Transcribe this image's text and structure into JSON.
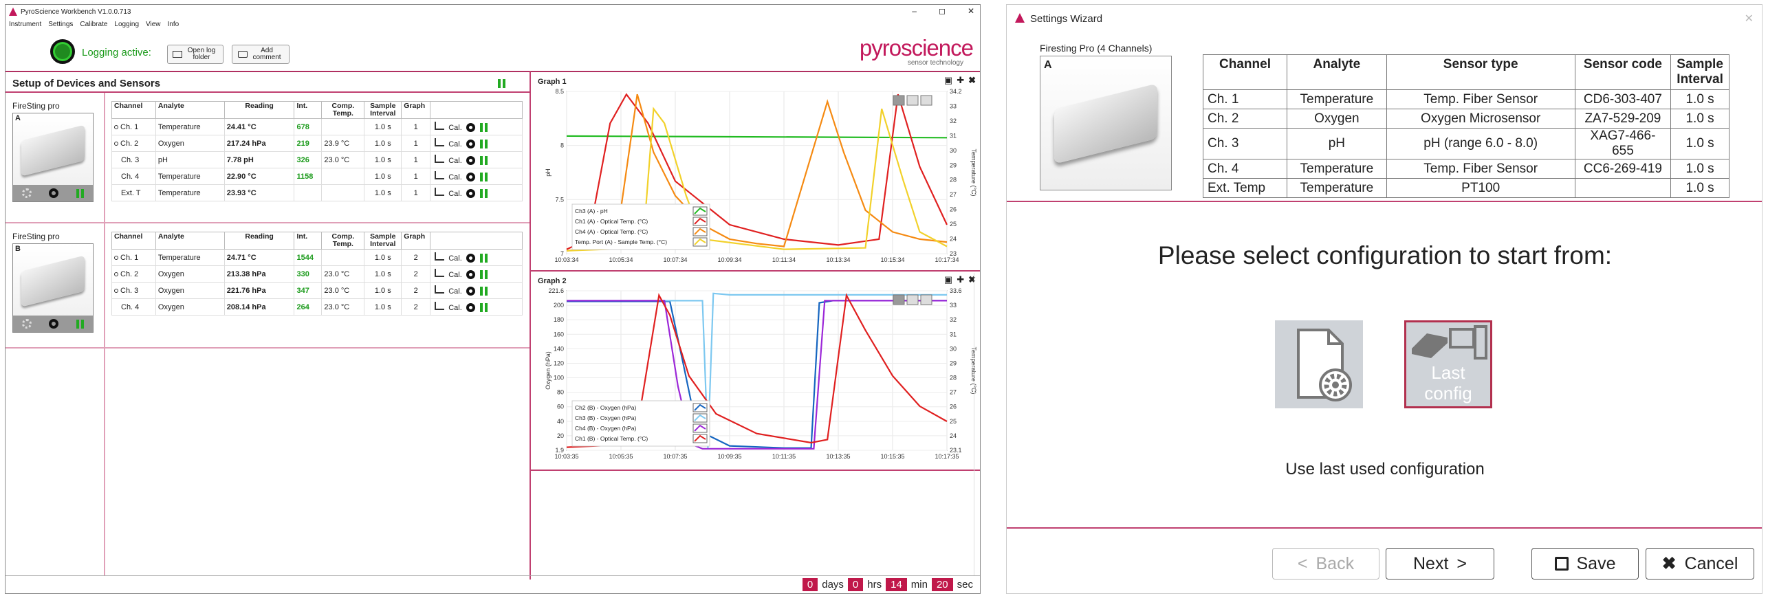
{
  "main": {
    "title": "PyroScience Workbench V1.0.0.713",
    "window_buttons": [
      "–",
      "◻",
      "✕"
    ],
    "menu": [
      "Instrument",
      "Settings",
      "Calibrate",
      "Logging",
      "View",
      "Info"
    ],
    "logging_status": "Logging active:",
    "open_log_folder": "Open log folder",
    "add_comment": "Add comment",
    "logo": "pyroscience",
    "logo_sub": "sensor technology",
    "setup_header": "Setup of Devices and Sensors",
    "headers": [
      "Channel",
      "Analyte",
      "Reading",
      "Int.",
      "Comp. Temp.",
      "Sample Interval",
      "Graph"
    ],
    "cal_label": "Cal.",
    "devices": [
      {
        "name": "FireSting pro",
        "letter": "A",
        "rows": [
          {
            "ch": "Ch. 1",
            "analyte": "Temperature",
            "reading": "24.41 °C",
            "int": "678",
            "comp": "",
            "si": "1.0 s",
            "graph": "1",
            "dot": true
          },
          {
            "ch": "Ch. 2",
            "analyte": "Oxygen",
            "reading": "217.24 hPa",
            "int": "219",
            "comp": "23.9 °C",
            "si": "1.0 s",
            "graph": "1",
            "dot": true
          },
          {
            "ch": "Ch. 3",
            "analyte": "pH",
            "reading": "7.78 pH",
            "int": "326",
            "comp": "23.0 °C",
            "si": "1.0 s",
            "graph": "1",
            "dot": false
          },
          {
            "ch": "Ch. 4",
            "analyte": "Temperature",
            "reading": "22.90 °C",
            "int": "1158",
            "comp": "",
            "si": "1.0 s",
            "graph": "1",
            "dot": false
          },
          {
            "ch": "Ext. T",
            "analyte": "Temperature",
            "reading": "23.93 °C",
            "int": "",
            "comp": "",
            "si": "1.0 s",
            "graph": "1",
            "dot": false
          }
        ]
      },
      {
        "name": "FireSting pro",
        "letter": "B",
        "rows": [
          {
            "ch": "Ch. 1",
            "analyte": "Temperature",
            "reading": "24.71 °C",
            "int": "1544",
            "comp": "",
            "si": "1.0 s",
            "graph": "2",
            "dot": true
          },
          {
            "ch": "Ch. 2",
            "analyte": "Oxygen",
            "reading": "213.38 hPa",
            "int": "330",
            "comp": "23.0 °C",
            "si": "1.0 s",
            "graph": "2",
            "dot": true
          },
          {
            "ch": "Ch. 3",
            "analyte": "Oxygen",
            "reading": "221.76 hPa",
            "int": "347",
            "comp": "23.0 °C",
            "si": "1.0 s",
            "graph": "2",
            "dot": true
          },
          {
            "ch": "Ch. 4",
            "analyte": "Oxygen",
            "reading": "208.14 hPa",
            "int": "264",
            "comp": "23.0 °C",
            "si": "1.0 s",
            "graph": "2",
            "dot": false
          }
        ]
      }
    ],
    "graph1": {
      "title": "Graph 1"
    },
    "graph2": {
      "title": "Graph 2"
    },
    "elapsed": {
      "days": "0",
      "days_label": "days",
      "hrs": "0",
      "hrs_label": "hrs",
      "min": "14",
      "min_label": "min",
      "sec": "20",
      "sec_label": "sec"
    }
  },
  "chart_data": [
    {
      "type": "line",
      "title": "Graph 1",
      "ylabel": "pH",
      "y2label": "Temperature (°C)",
      "ylim": [
        6.5,
        8.5
      ],
      "y2lim": [
        23,
        34.2
      ],
      "yticks": [
        "8.5",
        "8",
        "7.5",
        "7"
      ],
      "y2ticks": [
        "34.2",
        "33",
        "32",
        "31",
        "30",
        "29",
        "28",
        "27",
        "26",
        "25",
        "24",
        "23"
      ],
      "x_ticks": [
        "10:03:34",
        "10:05:34",
        "10:07:34",
        "10:09:34",
        "10:11:34",
        "10:13:34",
        "10:15:34",
        "10:17:34"
      ],
      "grid": true,
      "legend_position": "bottom-left",
      "series": [
        {
          "name": "Ch3 (A) - pH",
          "color": "#22bb22",
          "axis": "left",
          "x": [
            0,
            14
          ],
          "y": [
            7.95,
            7.93
          ]
        },
        {
          "name": "Ch1 (A) - Optical Temp. (°C)",
          "color": "#e02020",
          "axis": "right",
          "x": [
            0,
            0.8,
            1.6,
            2.2,
            3,
            4,
            6,
            8,
            10,
            11.5,
            12.2,
            13,
            14
          ],
          "y": [
            23.3,
            24,
            32,
            34,
            32,
            28,
            25,
            24,
            23.6,
            24,
            34,
            29,
            25
          ]
        },
        {
          "name": "Ch4 (A) - Optical Temp. (°C)",
          "color": "#f58a12",
          "axis": "right",
          "x": [
            0,
            1.8,
            2.6,
            3.2,
            4,
            5,
            6,
            7,
            8,
            9.6,
            10.2,
            11,
            12,
            13,
            14
          ],
          "y": [
            23.2,
            23.5,
            34,
            30,
            27,
            25,
            24,
            23.7,
            23.5,
            33.5,
            30,
            26,
            24.5,
            24,
            23.8
          ]
        },
        {
          "name": "Temp. Port (A) - Sample Temp. (°C)",
          "color": "#f2d12a",
          "axis": "right",
          "x": [
            0,
            2.8,
            3.2,
            3.6,
            4.4,
            5,
            8,
            11,
            11.6,
            12.4,
            13,
            14
          ],
          "y": [
            23.2,
            23.4,
            33,
            32,
            27,
            24,
            23.3,
            23.4,
            33,
            28,
            24.5,
            23.5
          ]
        }
      ]
    },
    {
      "type": "line",
      "title": "Graph 2",
      "ylabel": "Oxygen (hPa)",
      "y2label": "Temperature (°C)",
      "ylim": [
        1.9,
        221.6
      ],
      "y2lim": [
        23.1,
        33.6
      ],
      "yticks": [
        "221.6",
        "200",
        "180",
        "160",
        "140",
        "120",
        "100",
        "80",
        "60",
        "40",
        "20",
        "1.9"
      ],
      "y2ticks": [
        "33.6",
        "33",
        "32",
        "31",
        "30",
        "29",
        "28",
        "27",
        "26",
        "25",
        "24",
        "23.1"
      ],
      "x_ticks": [
        "10:03:35",
        "10:05:35",
        "10:07:35",
        "10:09:35",
        "10:11:35",
        "10:13:35",
        "10:15:35",
        "10:17:35"
      ],
      "grid": true,
      "legend_position": "bottom-left",
      "series": [
        {
          "name": "Ch2 (B) - Oxygen (hPa)",
          "color": "#1565c0",
          "axis": "left",
          "x": [
            0,
            3.8,
            4.3,
            4.8,
            6,
            8,
            9,
            9.3,
            9.8,
            14
          ],
          "y": [
            207,
            207,
            120,
            30,
            8,
            5,
            5,
            205,
            208,
            208
          ]
        },
        {
          "name": "Ch3 (B) - Oxygen (hPa)",
          "color": "#7dc8f0",
          "axis": "left",
          "x": [
            0,
            5,
            5.2,
            5.4,
            6,
            14
          ],
          "y": [
            208,
            208,
            5,
            218,
            216,
            216
          ]
        },
        {
          "name": "Ch4 (B) - Oxygen (hPa)",
          "color": "#9c27d8",
          "axis": "left",
          "x": [
            0,
            3.6,
            4.1,
            4.6,
            5,
            8,
            9.1,
            9.5,
            14
          ],
          "y": [
            208,
            208,
            90,
            10,
            4,
            4,
            4,
            208,
            208
          ]
        },
        {
          "name": "Ch1 (B) - Optical Temp. (°C)",
          "color": "#e02020",
          "axis": "right",
          "x": [
            0,
            2.5,
            3.4,
            3.8,
            4.5,
            5.5,
            7,
            9,
            9.6,
            10.3,
            11,
            12,
            13,
            14
          ],
          "y": [
            23.3,
            23.5,
            33.3,
            32,
            28,
            25.5,
            24.2,
            23.6,
            23.8,
            33.3,
            31,
            28,
            26,
            25
          ]
        }
      ]
    }
  ],
  "wizard": {
    "title": "Settings Wizard",
    "device_label": "Firesting Pro (4 Channels)",
    "device_letter": "A",
    "headers": [
      "Channel",
      "Analyte",
      "Sensor type",
      "Sensor code",
      "Sample Interval"
    ],
    "rows": [
      [
        "Ch. 1",
        "Temperature",
        "Temp. Fiber Sensor",
        "CD6-303-407",
        "1.0 s"
      ],
      [
        "Ch. 2",
        "Oxygen",
        "Oxygen Microsensor",
        "ZA7-529-209",
        "1.0 s"
      ],
      [
        "Ch. 3",
        "pH",
        "pH (range 6.0 - 8.0)",
        "XAG7-466-655",
        "1.0 s"
      ],
      [
        "Ch. 4",
        "Temperature",
        "Temp. Fiber Sensor",
        "CC6-269-419",
        "1.0 s"
      ],
      [
        "Ext. Temp",
        "Temperature",
        "PT100",
        "",
        "1.0 s"
      ]
    ],
    "prompt": "Please select configuration to start from:",
    "last_config": "Last config",
    "description": "Use last used configuration",
    "back": "Back",
    "next": "Next",
    "save": "Save",
    "cancel": "Cancel"
  }
}
